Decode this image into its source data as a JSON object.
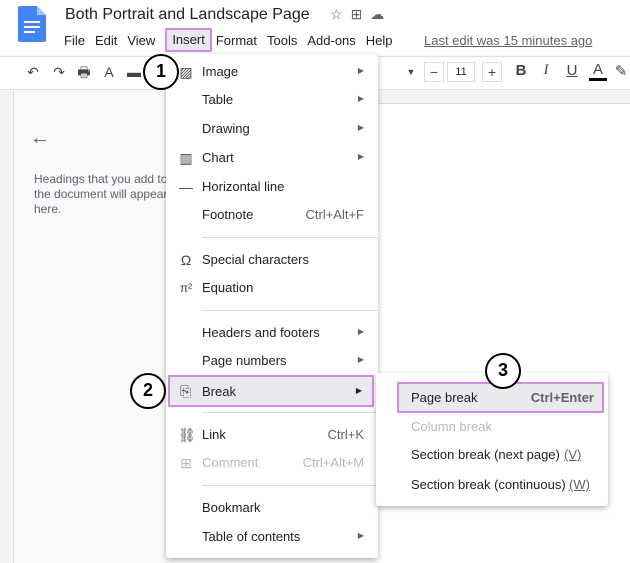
{
  "doc": {
    "title": "Both Portrait and Landscape Page",
    "title_icons": [
      "☆",
      "⊞",
      "☁"
    ]
  },
  "menubar": {
    "items": [
      "File",
      "Edit",
      "View",
      "Insert",
      "Format",
      "Tools",
      "Add-ons",
      "Help"
    ],
    "last_edit": "Last edit was 15 minutes ago"
  },
  "toolbar": {
    "font_size": "11",
    "buttons": [
      "↶",
      "↷",
      "🖶",
      "A",
      "▬"
    ],
    "format_buttons": [
      "B",
      "I",
      "U",
      "A",
      "✎"
    ],
    "size_minus": "−",
    "size_plus": "+"
  },
  "outline": {
    "back_icon": "←",
    "hint": "Headings that you add to the document will appear here."
  },
  "insert_menu": {
    "items": [
      {
        "icon": "▨",
        "label": "Image",
        "submenu": true
      },
      {
        "icon": "",
        "label": "Table",
        "submenu": true
      },
      {
        "icon": "",
        "label": "Drawing",
        "submenu": true
      },
      {
        "icon": "▥",
        "label": "Chart",
        "submenu": true
      },
      {
        "icon": "—",
        "label": "Horizontal line"
      },
      {
        "icon": "",
        "label": "Footnote",
        "shortcut": "Ctrl+Alt+F"
      },
      {
        "icon": "Ω",
        "label": "Special characters"
      },
      {
        "icon": "π²",
        "label": "Equation"
      },
      {
        "icon": "",
        "label": "Headers and footers",
        "submenu": true
      },
      {
        "icon": "",
        "label": "Page numbers",
        "submenu": true
      },
      {
        "icon": "⎘",
        "label": "Break",
        "submenu": true
      },
      {
        "icon": "⛓",
        "label": "Link",
        "shortcut": "Ctrl+K"
      },
      {
        "icon": "⊞",
        "label": "Comment",
        "shortcut": "Ctrl+Alt+M",
        "disabled": true
      },
      {
        "icon": "",
        "label": "Bookmark"
      },
      {
        "icon": "",
        "label": "Table of contents",
        "submenu": true
      }
    ]
  },
  "break_submenu": {
    "items": [
      {
        "label": "Page break",
        "shortcut": "Ctrl+Enter"
      },
      {
        "label": "Column break",
        "disabled": true
      },
      {
        "label": "Section break (next page)",
        "shortcut": "(V)"
      },
      {
        "label": "Section break (continuous)",
        "shortcut": "(W)"
      }
    ]
  },
  "callouts": [
    "1",
    "2",
    "3"
  ],
  "colors": {
    "highlight": "#d58ce0",
    "menu_bg": "#ffffff",
    "hover": "#e8eaed",
    "doc_icon": "#4285f4"
  }
}
